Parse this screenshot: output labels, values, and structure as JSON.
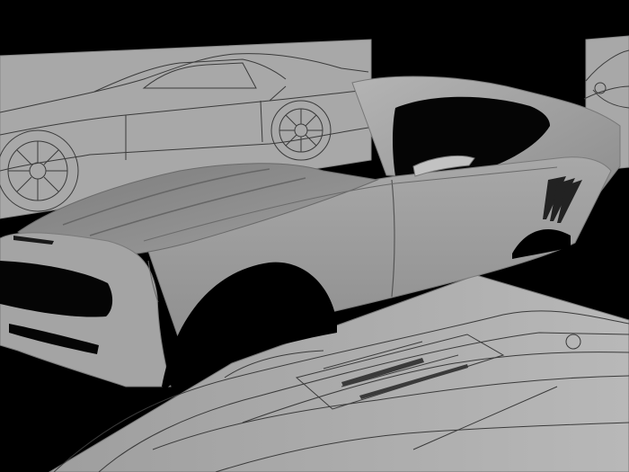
{
  "scene": {
    "background_color": "#000000",
    "blueprint_plane_color": "#a9a9a9",
    "car_body_color": "#9c9c9c",
    "line_color": "#2e2e2e",
    "blueprints": [
      "side-view",
      "front-view",
      "top-view"
    ]
  }
}
